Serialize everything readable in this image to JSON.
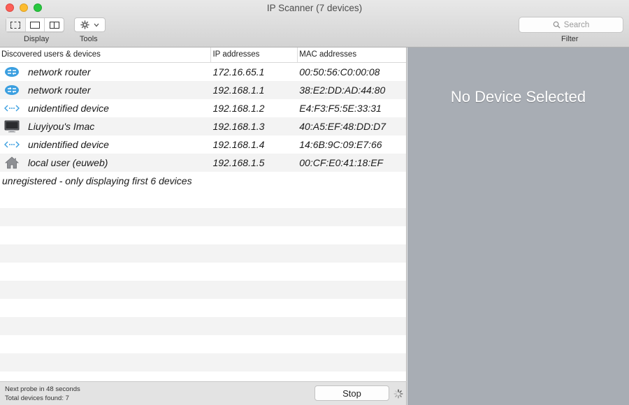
{
  "window": {
    "title": "IP Scanner (7 devices)"
  },
  "toolbar": {
    "display_label": "Display",
    "tools_label": "Tools",
    "filter_label": "Filter",
    "search_placeholder": "Search"
  },
  "list": {
    "headers": {
      "devices": "Discovered users & devices",
      "ip": "IP addresses",
      "mac": "MAC addresses"
    },
    "rows": [
      {
        "icon": "router-icon",
        "name": "network router",
        "ip": "172.16.65.1",
        "mac": "00:50:56:C0:00:08"
      },
      {
        "icon": "router-icon",
        "name": "network router",
        "ip": "192.168.1.1",
        "mac": "38:E2:DD:AD:44:80"
      },
      {
        "icon": "network-device-icon",
        "name": "unidentified device",
        "ip": "192.168.1.2",
        "mac": "E4:F3:F5:5E:33:31"
      },
      {
        "icon": "imac-icon",
        "name": "Liuyiyou's Imac",
        "ip": "192.168.1.3",
        "mac": "40:A5:EF:48:DD:D7"
      },
      {
        "icon": "network-device-icon",
        "name": "unidentified device",
        "ip": "192.168.1.4",
        "mac": "14:6B:9C:09:E7:66"
      },
      {
        "icon": "home-icon",
        "name": "local user (euweb)",
        "ip": "192.168.1.5",
        "mac": "00:CF:E0:41:18:EF"
      }
    ],
    "note": "unregistered - only displaying first 6 devices"
  },
  "status": {
    "next_probe": "Next probe in 48 seconds",
    "total_found": "Total devices found: 7",
    "stop_label": "Stop"
  },
  "detail": {
    "empty_message": "No Device Selected"
  },
  "colors": {
    "router_blue": "#3b9fe0",
    "detail_bg": "#a8adb4",
    "close": "#fc5f57",
    "minimize": "#fdbc2e",
    "zoom": "#28c840"
  }
}
